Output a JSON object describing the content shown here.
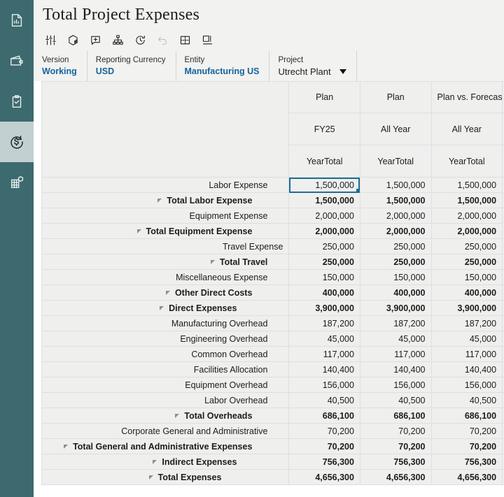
{
  "sidebar": {
    "items": [
      {
        "name": "reports",
        "icon": "report-chart-icon",
        "active": false
      },
      {
        "name": "wallet",
        "icon": "wallet-icon",
        "active": false
      },
      {
        "name": "tasks",
        "icon": "clipboard-check-icon",
        "active": false
      },
      {
        "name": "financials",
        "icon": "dollar-refresh-icon",
        "active": true
      },
      {
        "name": "data",
        "icon": "grid-cube-icon",
        "active": false
      }
    ]
  },
  "header": {
    "title": "Total Project Expenses"
  },
  "toolbar": {
    "buttons": [
      {
        "name": "adjust-settings-button",
        "icon": "sliders-icon",
        "disabled": false
      },
      {
        "name": "analyze-cube-button",
        "icon": "data-cube-icon",
        "disabled": false
      },
      {
        "name": "add-comment-button",
        "icon": "comment-plus-icon",
        "disabled": false
      },
      {
        "name": "hierarchy-button",
        "icon": "org-tree-icon",
        "disabled": false
      },
      {
        "name": "history-button",
        "icon": "clock-history-icon",
        "disabled": false
      },
      {
        "name": "undo-button",
        "icon": "undo-arrow-icon",
        "disabled": true
      },
      {
        "name": "freeze-grid-button",
        "icon": "grid-freeze-icon",
        "disabled": false
      },
      {
        "name": "layout-split-button",
        "icon": "layout-split-icon",
        "disabled": false
      }
    ]
  },
  "pov": [
    {
      "label": "Version",
      "value": "Working",
      "style": "link",
      "caret": false
    },
    {
      "label": "Reporting Currency",
      "value": "USD",
      "style": "link",
      "caret": false
    },
    {
      "label": "Entity",
      "value": "Manufacturing US",
      "style": "link",
      "caret": false
    },
    {
      "label": "Project",
      "value": "Utrecht Plant",
      "style": "plain",
      "caret": true
    }
  ],
  "grid": {
    "column_headers": {
      "scenario": [
        "Plan",
        "Plan",
        "Plan vs. Forecast"
      ],
      "year": [
        "FY25",
        "All Year",
        "All Year"
      ],
      "period": [
        "YearTotal",
        "YearTotal",
        "YearTotal"
      ]
    },
    "rows": [
      {
        "label": "Labor Expense",
        "indent": 3,
        "bold": false,
        "collapse": false,
        "values": [
          "1,500,000",
          "1,500,000",
          "1,500,000"
        ]
      },
      {
        "label": "Total Labor Expense",
        "indent": 2,
        "bold": true,
        "collapse": true,
        "values": [
          "1,500,000",
          "1,500,000",
          "1,500,000"
        ]
      },
      {
        "label": "Equipment Expense",
        "indent": 3,
        "bold": false,
        "collapse": false,
        "values": [
          "2,000,000",
          "2,000,000",
          "2,000,000"
        ]
      },
      {
        "label": "Total Equipment Expense",
        "indent": 2,
        "bold": true,
        "collapse": true,
        "values": [
          "2,000,000",
          "2,000,000",
          "2,000,000"
        ]
      },
      {
        "label": "Travel Expense",
        "indent": 4,
        "bold": false,
        "collapse": false,
        "values": [
          "250,000",
          "250,000",
          "250,000"
        ]
      },
      {
        "label": "Total Travel",
        "indent": 3,
        "bold": true,
        "collapse": true,
        "values": [
          "250,000",
          "250,000",
          "250,000"
        ]
      },
      {
        "label": "Miscellaneous Expense",
        "indent": 3,
        "bold": false,
        "collapse": false,
        "values": [
          "150,000",
          "150,000",
          "150,000"
        ]
      },
      {
        "label": "Other Direct Costs",
        "indent": 2,
        "bold": true,
        "collapse": true,
        "values": [
          "400,000",
          "400,000",
          "400,000"
        ]
      },
      {
        "label": "Direct Expenses",
        "indent": 1,
        "bold": true,
        "collapse": true,
        "values": [
          "3,900,000",
          "3,900,000",
          "3,900,000"
        ]
      },
      {
        "label": "Manufacturing Overhead",
        "indent": 3,
        "bold": false,
        "collapse": false,
        "values": [
          "187,200",
          "187,200",
          "187,200"
        ]
      },
      {
        "label": "Engineering Overhead",
        "indent": 3,
        "bold": false,
        "collapse": false,
        "values": [
          "45,000",
          "45,000",
          "45,000"
        ]
      },
      {
        "label": "Common Overhead",
        "indent": 3,
        "bold": false,
        "collapse": false,
        "values": [
          "117,000",
          "117,000",
          "117,000"
        ]
      },
      {
        "label": "Facilities Allocation",
        "indent": 3,
        "bold": false,
        "collapse": false,
        "values": [
          "140,400",
          "140,400",
          "140,400"
        ]
      },
      {
        "label": "Equipment Overhead",
        "indent": 3,
        "bold": false,
        "collapse": false,
        "values": [
          "156,000",
          "156,000",
          "156,000"
        ]
      },
      {
        "label": "Labor Overhead",
        "indent": 3,
        "bold": false,
        "collapse": false,
        "values": [
          "40,500",
          "40,500",
          "40,500"
        ]
      },
      {
        "label": "Total Overheads",
        "indent": 2,
        "bold": true,
        "collapse": true,
        "values": [
          "686,100",
          "686,100",
          "686,100"
        ]
      },
      {
        "label": "Corporate General and Administrative",
        "indent": 3,
        "bold": false,
        "collapse": false,
        "values": [
          "70,200",
          "70,200",
          "70,200"
        ]
      },
      {
        "label": "Total General and Administrative Expenses",
        "indent": 2,
        "bold": true,
        "collapse": true,
        "values": [
          "70,200",
          "70,200",
          "70,200"
        ]
      },
      {
        "label": "Indirect Expenses",
        "indent": 1,
        "bold": true,
        "collapse": true,
        "values": [
          "756,300",
          "756,300",
          "756,300"
        ]
      },
      {
        "label": "Total Expenses",
        "indent": 0,
        "bold": true,
        "collapse": true,
        "values": [
          "4,656,300",
          "4,656,300",
          "4,656,300"
        ]
      }
    ],
    "selected_cell": {
      "row": 0,
      "col": 0
    }
  },
  "colors": {
    "sidebar_bg": "#3d6a6e",
    "sidebar_active_bg": "#c3d0d1",
    "panel_bg": "#f2f2f0",
    "grid_cell_bg": "#efefed",
    "grid_line": "#dbe0e4",
    "link": "#14639e",
    "selection": "#1b6f91"
  }
}
